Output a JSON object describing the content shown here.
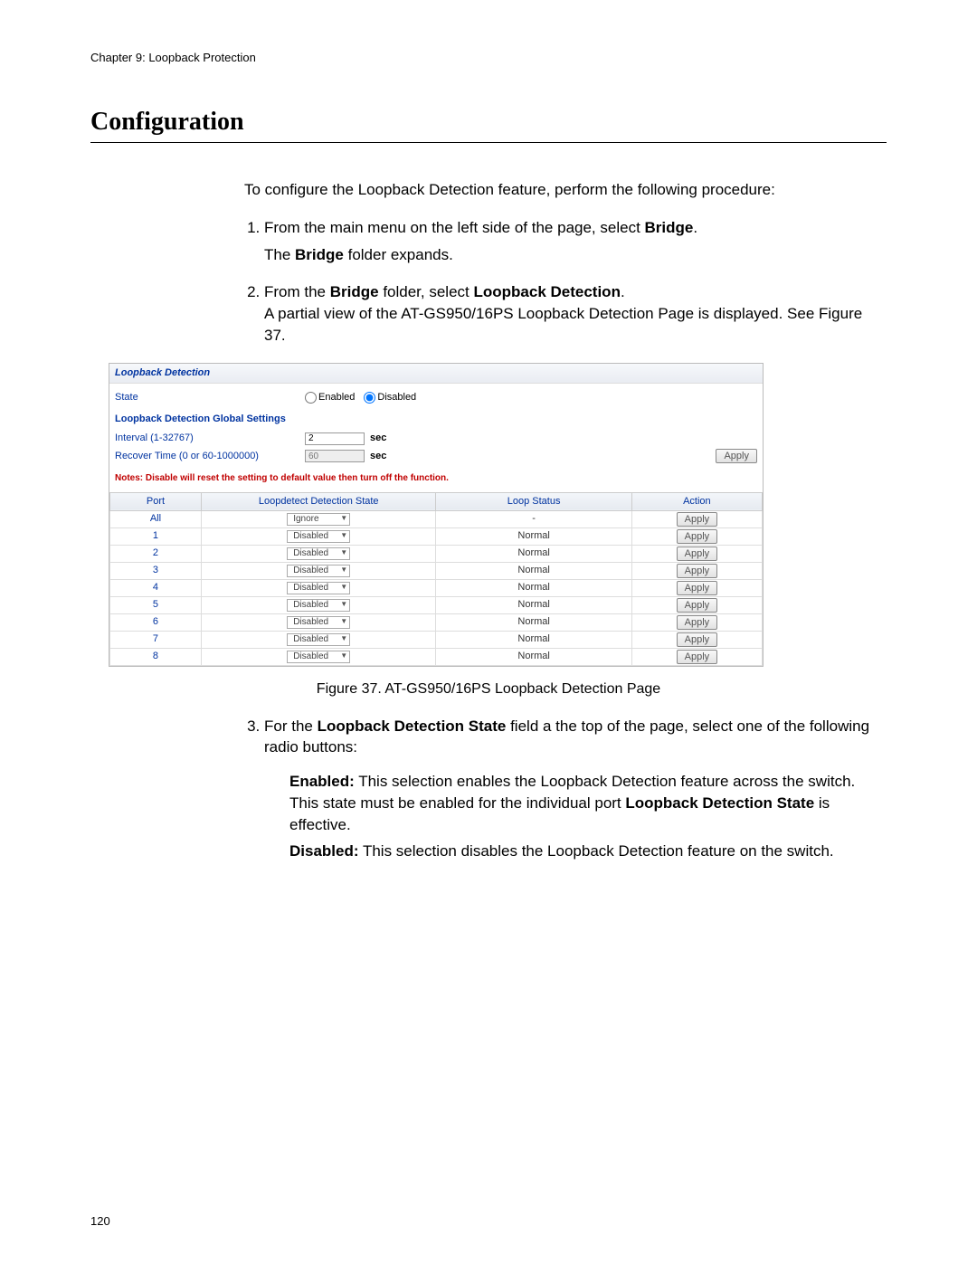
{
  "chapter": "Chapter 9: Loopback Protection",
  "section_title": "Configuration",
  "page_number": "120",
  "intro": "To configure the Loopback Detection feature, perform the following procedure:",
  "steps": {
    "s1_pre": "From the main menu on the left side of the page, select ",
    "s1_bold": "Bridge",
    "s1_post": ".",
    "s1_sub_a": "The ",
    "s1_sub_bold": "Bridge",
    "s1_sub_b": " folder expands.",
    "s2_pre": "From the ",
    "s2_bold1": "Bridge",
    "s2_mid": " folder, select ",
    "s2_bold2": "Loopback Detection",
    "s2_post": ".",
    "s2_line2": "A partial view of the AT-GS950/16PS Loopback Detection Page is displayed. See Figure 37.",
    "s3_pre": "For the ",
    "s3_bold": "Loopback Detection State",
    "s3_post": " field a the top of the page, select one of the following radio buttons:",
    "opt_enabled_label": "Enabled:",
    "opt_enabled_text_a": " This selection enables the Loopback Detection feature across the switch. This state must be enabled for the individual port ",
    "opt_enabled_bold_inner": "Loopback Detection State",
    "opt_enabled_text_b": " is effective.",
    "opt_disabled_label": "Disabled:",
    "opt_disabled_text": " This selection disables the Loopback Detection feature on the switch."
  },
  "caption": "Figure 37. AT-GS950/16PS Loopback Detection Page",
  "ui": {
    "panel_title": "Loopback Detection",
    "state_label": "State",
    "radio_enabled": "Enabled",
    "radio_disabled": "Disabled",
    "global_heading": "Loopback Detection Global Settings",
    "interval_label": "Interval (1-32767)",
    "interval_value": "2",
    "recover_label": "Recover Time (0 or 60-1000000)",
    "recover_value": "60",
    "unit_sec": "sec",
    "apply_label": "Apply",
    "notice": "Notes: Disable will reset the setting to default value then turn off the function.",
    "columns": {
      "port": "Port",
      "state": "Loopdetect Detection State",
      "loop": "Loop Status",
      "action": "Action"
    },
    "rows": [
      {
        "port": "All",
        "state": "Ignore",
        "loop": "-",
        "action": "Apply"
      },
      {
        "port": "1",
        "state": "Disabled",
        "loop": "Normal",
        "action": "Apply"
      },
      {
        "port": "2",
        "state": "Disabled",
        "loop": "Normal",
        "action": "Apply"
      },
      {
        "port": "3",
        "state": "Disabled",
        "loop": "Normal",
        "action": "Apply"
      },
      {
        "port": "4",
        "state": "Disabled",
        "loop": "Normal",
        "action": "Apply"
      },
      {
        "port": "5",
        "state": "Disabled",
        "loop": "Normal",
        "action": "Apply"
      },
      {
        "port": "6",
        "state": "Disabled",
        "loop": "Normal",
        "action": "Apply"
      },
      {
        "port": "7",
        "state": "Disabled",
        "loop": "Normal",
        "action": "Apply"
      },
      {
        "port": "8",
        "state": "Disabled",
        "loop": "Normal",
        "action": "Apply"
      }
    ]
  }
}
